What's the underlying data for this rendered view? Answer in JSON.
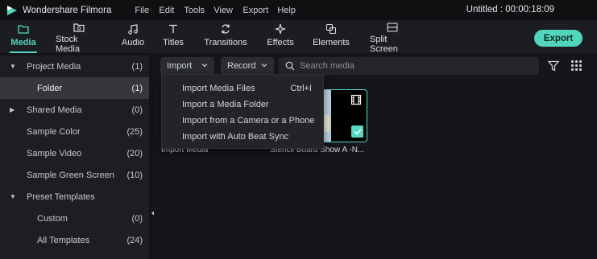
{
  "app": {
    "name": "Wondershare Filmora",
    "project_title": "Untitled : 00:00:18:09",
    "accent": "#55d7c2"
  },
  "menu": [
    "File",
    "Edit",
    "Tools",
    "View",
    "Export",
    "Help"
  ],
  "toolbar": {
    "tabs": [
      {
        "label": "Media",
        "icon": "folder-icon",
        "active": true
      },
      {
        "label": "Stock Media",
        "icon": "stock-media-icon",
        "active": false
      },
      {
        "label": "Audio",
        "icon": "music-note-icon",
        "active": false
      },
      {
        "label": "Titles",
        "icon": "text-icon",
        "active": false
      },
      {
        "label": "Transitions",
        "icon": "transitions-icon",
        "active": false
      },
      {
        "label": "Effects",
        "icon": "sparkle-icon",
        "active": false
      },
      {
        "label": "Elements",
        "icon": "elements-icon",
        "active": false
      },
      {
        "label": "Split Screen",
        "icon": "split-screen-icon",
        "active": false
      }
    ],
    "export_label": "Export"
  },
  "sidebar": {
    "items": [
      {
        "label": "Project Media",
        "count": "(1)",
        "expanded": true,
        "indent": 1
      },
      {
        "label": "Folder",
        "count": "(1)",
        "selected": true,
        "indent": 2
      },
      {
        "label": "Shared Media",
        "count": "(0)",
        "expanded": false,
        "indent": 1
      },
      {
        "label": "Sample Color",
        "count": "(25)",
        "indent": 1
      },
      {
        "label": "Sample Video",
        "count": "(20)",
        "indent": 1
      },
      {
        "label": "Sample Green Screen",
        "count": "(10)",
        "indent": 1
      },
      {
        "label": "Preset Templates",
        "count": "",
        "expanded": true,
        "indent": 1
      },
      {
        "label": "Custom",
        "count": "(0)",
        "indent": 2
      },
      {
        "label": "All Templates",
        "count": "(24)",
        "indent": 2
      }
    ]
  },
  "media_toolbar": {
    "import_label": "Import",
    "record_label": "Record",
    "search_placeholder": "Search media"
  },
  "media_items": [
    {
      "label": "Import Media"
    },
    {
      "label": "Stencil Board Show A -N..."
    }
  ],
  "import_menu": {
    "items": [
      {
        "label": "Import Media Files",
        "shortcut": "Ctrl+I"
      },
      {
        "label": "Import a Media Folder",
        "shortcut": ""
      },
      {
        "label": "Import from a Camera or a Phone",
        "shortcut": ""
      },
      {
        "label": "Import with Auto Beat Sync",
        "shortcut": ""
      }
    ]
  }
}
